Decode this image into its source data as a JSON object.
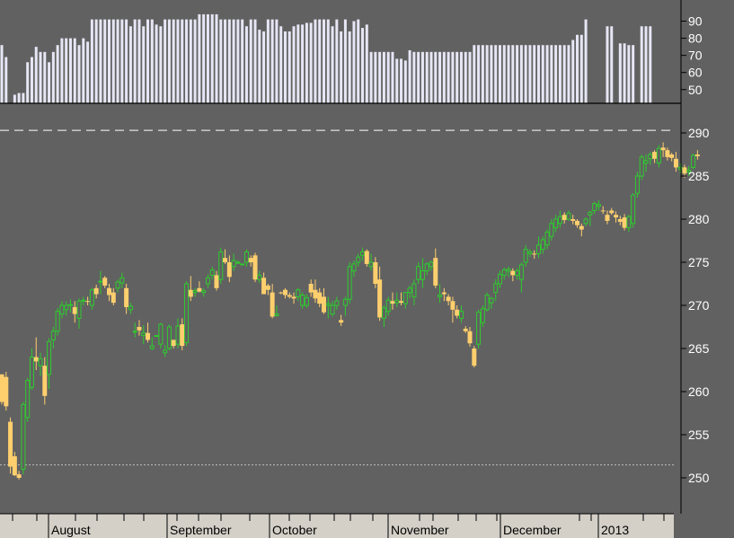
{
  "chart_data": [
    {
      "type": "bar",
      "panel": "indicator",
      "ylim": [
        42,
        95
      ],
      "y_ticks": [
        "50",
        "60",
        "70",
        "80",
        "90"
      ],
      "bar_color": "#e6e6f5",
      "values": [
        76,
        69,
        null,
        47,
        48,
        48,
        66,
        69,
        75,
        72,
        72,
        66,
        72,
        76,
        80,
        80,
        80,
        80,
        76,
        80,
        78,
        91,
        91,
        91,
        91,
        91,
        91,
        91,
        91,
        91,
        87,
        91,
        91,
        87,
        91,
        91,
        88,
        87,
        91,
        91,
        91,
        91,
        91,
        91,
        91,
        91,
        94,
        94,
        94,
        94,
        94,
        91,
        91,
        91,
        91,
        91,
        91,
        87,
        91,
        91,
        85,
        84,
        91,
        91,
        91,
        87,
        84,
        84,
        87,
        88,
        88,
        89,
        89,
        91,
        91,
        91,
        91,
        87,
        91,
        84,
        91,
        84,
        90,
        91,
        86,
        88,
        72,
        72,
        72,
        72,
        72,
        72,
        68,
        68,
        67,
        73,
        72,
        72,
        72,
        72,
        72,
        72,
        72,
        72,
        72,
        72,
        72,
        72,
        72,
        72,
        76,
        76,
        76,
        76,
        76,
        76,
        76,
        76,
        76,
        76,
        76,
        76,
        76,
        76,
        76,
        76,
        76,
        76,
        76,
        76,
        76,
        76,
        76,
        79,
        82,
        82,
        91,
        null,
        null,
        null,
        null,
        87,
        87,
        null,
        77,
        77,
        76,
        76,
        null,
        87,
        87,
        87
      ]
    },
    {
      "type": "candlestick",
      "panel": "price",
      "ylim": [
        246,
        292
      ],
      "y_ticks": [
        "250",
        "255",
        "260",
        "265",
        "270",
        "275",
        "280",
        "285",
        "290"
      ],
      "up_color": "#2ecc2e",
      "down_color": "#ffcf6e",
      "reference_lines": [
        290.3,
        251.5
      ],
      "months": [
        "August",
        "September",
        "October",
        "November",
        "December",
        "2013"
      ],
      "candles": [
        [
          262.0,
          262.0,
          258.5,
          258.8
        ],
        [
          261.7,
          262.3,
          257.8,
          258.3
        ],
        [
          256.5,
          257.0,
          250.5,
          251.3
        ],
        [
          252.5,
          253.0,
          250.2,
          250.3
        ],
        [
          250.4,
          250.8,
          249.8,
          250.0
        ],
        [
          251.0,
          258.8,
          250.4,
          258.5
        ],
        [
          257.0,
          261.6,
          256.5,
          261.3
        ],
        [
          260.5,
          265.0,
          260.2,
          264.0
        ],
        [
          264.0,
          266.3,
          262.5,
          263.5
        ],
        [
          263.0,
          264.5,
          261.8,
          263.8
        ],
        [
          263.0,
          264.0,
          258.5,
          259.5
        ],
        [
          262.0,
          266.2,
          260.3,
          265.8
        ],
        [
          266.0,
          267.5,
          265.0,
          267.0
        ],
        [
          267.0,
          269.7,
          266.5,
          269.3
        ],
        [
          269.0,
          270.5,
          268.5,
          270.0
        ],
        [
          269.5,
          270.5,
          268.8,
          270.0
        ],
        [
          270.0,
          270.7,
          269.2,
          270.1
        ],
        [
          269.8,
          270.5,
          268.0,
          269.0
        ],
        [
          268.5,
          270.8,
          267.3,
          270.5
        ],
        [
          270.5,
          271.0,
          270.0,
          270.6
        ],
        [
          270.5,
          271.0,
          270.0,
          270.4
        ],
        [
          270.0,
          272.0,
          269.5,
          271.8
        ],
        [
          272.0,
          272.4,
          270.8,
          271.3
        ],
        [
          272.8,
          274.0,
          271.3,
          272.8
        ],
        [
          273.2,
          273.4,
          272.0,
          272.3
        ],
        [
          272.0,
          272.5,
          270.5,
          271.2
        ],
        [
          271.5,
          272.0,
          270.0,
          270.3
        ],
        [
          272.0,
          273.0,
          271.5,
          272.7
        ],
        [
          272.6,
          273.8,
          272.0,
          273.2
        ],
        [
          272.0,
          272.5,
          269.0,
          269.8
        ],
        [
          269.5,
          270.3,
          269.0,
          269.9
        ],
        [
          267.0,
          268.0,
          266.3,
          267.0
        ],
        [
          267.5,
          268.3,
          266.5,
          267.1
        ],
        [
          266.5,
          267.7,
          265.5,
          266.8
        ],
        [
          266.8,
          268.0,
          265.7,
          266.0
        ],
        [
          265.0,
          266.3,
          264.8,
          265.3
        ],
        [
          266.5,
          266.5,
          266.5,
          266.5
        ],
        [
          265.5,
          268.0,
          265.0,
          267.8
        ],
        [
          264.5,
          265.4,
          264.0,
          264.8
        ],
        [
          265.0,
          267.8,
          264.8,
          267.5
        ],
        [
          266.0,
          266.0,
          265.0,
          265.3
        ],
        [
          265.5,
          268.5,
          265.0,
          267.6
        ],
        [
          267.8,
          268.5,
          264.8,
          265.3
        ],
        [
          265.7,
          272.8,
          265.3,
          272.5
        ],
        [
          271.8,
          273.4,
          270.5,
          271.0
        ],
        [
          271.5,
          272.0,
          271.0,
          271.7
        ],
        [
          272.0,
          272.8,
          271.5,
          271.6
        ],
        [
          271.5,
          272.0,
          271.0,
          271.7
        ],
        [
          272.5,
          273.6,
          272.0,
          273.2
        ],
        [
          273.5,
          274.5,
          273.0,
          274.1
        ],
        [
          273.5,
          274.0,
          271.7,
          272.0
        ],
        [
          273.0,
          276.7,
          272.5,
          276.2
        ],
        [
          275.5,
          276.5,
          274.8,
          275.0
        ],
        [
          275.0,
          275.8,
          272.7,
          273.3
        ],
        [
          274.5,
          276.0,
          274.0,
          275.2
        ],
        [
          274.9,
          275.2,
          274.8,
          275.0
        ],
        [
          274.8,
          274.8,
          274.8,
          274.8
        ],
        [
          275.0,
          276.5,
          274.5,
          276.2
        ],
        [
          275.5,
          275.8,
          274.5,
          275.0
        ],
        [
          275.8,
          276.1,
          272.7,
          273.0
        ],
        [
          273.0,
          274.0,
          272.6,
          273.5
        ],
        [
          273.2,
          273.8,
          271.3,
          271.3
        ],
        [
          272.3,
          272.5,
          271.2,
          271.8
        ],
        [
          271.5,
          272.5,
          268.5,
          268.7
        ],
        [
          268.8,
          270.0,
          268.7,
          269.0
        ],
        [
          271.5,
          271.6,
          271.3,
          271.4
        ],
        [
          271.8,
          272.0,
          270.8,
          271.2
        ],
        [
          271.2,
          271.5,
          270.8,
          271.0
        ],
        [
          271.0,
          271.5,
          270.2,
          270.8
        ],
        [
          271.0,
          272.0,
          270.5,
          271.8
        ],
        [
          270.0,
          271.5,
          269.6,
          271.2
        ],
        [
          270.0,
          271.3,
          269.7,
          270.9
        ],
        [
          272.5,
          273.0,
          271.0,
          271.5
        ],
        [
          271.8,
          273.0,
          270.3,
          270.8
        ],
        [
          271.5,
          272.0,
          269.8,
          270.2
        ],
        [
          271.0,
          272.0,
          269.0,
          269.2
        ],
        [
          270.0,
          271.0,
          268.5,
          270.2
        ],
        [
          269.0,
          270.5,
          268.7,
          270.0
        ],
        [
          270.0,
          271.0,
          269.5,
          270.5
        ],
        [
          268.3,
          268.9,
          267.6,
          268.0
        ],
        [
          270.0,
          271.0,
          268.8,
          270.7
        ],
        [
          270.7,
          275.0,
          270.2,
          274.5
        ],
        [
          274.0,
          275.2,
          273.3,
          274.8
        ],
        [
          275.0,
          276.0,
          274.5,
          275.6
        ],
        [
          275.8,
          276.7,
          275.2,
          276.2
        ],
        [
          276.3,
          276.5,
          274.5,
          274.8
        ],
        [
          274.5,
          276.0,
          274.0,
          275.0
        ],
        [
          275.0,
          275.6,
          272.0,
          272.5
        ],
        [
          273.0,
          274.5,
          268.2,
          268.6
        ],
        [
          268.5,
          270.0,
          267.5,
          269.7
        ],
        [
          269.3,
          271.0,
          268.8,
          270.6
        ],
        [
          270.5,
          271.5,
          269.5,
          270.2
        ],
        [
          270.3,
          271.5,
          269.8,
          270.6
        ],
        [
          270.5,
          271.5,
          270.0,
          270.3
        ],
        [
          270.2,
          271.5,
          269.6,
          271.5
        ],
        [
          271.5,
          272.3,
          270.8,
          272.0
        ],
        [
          271.0,
          273.0,
          270.0,
          272.5
        ],
        [
          273.0,
          275.0,
          272.5,
          274.5
        ],
        [
          273.0,
          275.5,
          272.0,
          274.0
        ],
        [
          274.0,
          275.0,
          273.5,
          274.8
        ],
        [
          274.5,
          275.2,
          274.0,
          275.0
        ],
        [
          275.5,
          276.6,
          272.0,
          272.3
        ],
        [
          271.0,
          272.5,
          270.3,
          271.2
        ],
        [
          271.5,
          272.0,
          270.5,
          271.3
        ],
        [
          271.0,
          271.3,
          270.0,
          270.5
        ],
        [
          270.5,
          271.0,
          268.0,
          269.5
        ],
        [
          269.5,
          270.0,
          268.5,
          268.8
        ],
        [
          268.5,
          270.0,
          268.0,
          269.3
        ],
        [
          267.3,
          267.6,
          266.8,
          267.0
        ],
        [
          267.0,
          267.5,
          265.2,
          265.6
        ],
        [
          265.0,
          265.3,
          262.8,
          263.0
        ],
        [
          265.5,
          269.5,
          265.0,
          269.2
        ],
        [
          268.0,
          270.0,
          267.5,
          269.6
        ],
        [
          269.5,
          271.5,
          269.3,
          271.2
        ],
        [
          270.3,
          271.0,
          269.6,
          270.8
        ],
        [
          271.5,
          273.0,
          270.5,
          272.5
        ],
        [
          272.5,
          274.0,
          272.0,
          273.6
        ],
        [
          273.5,
          274.4,
          273.0,
          274.1
        ],
        [
          274.0,
          274.5,
          273.3,
          274.2
        ],
        [
          274.0,
          274.3,
          272.8,
          273.5
        ],
        [
          273.5,
          274.3,
          273.0,
          274.0
        ],
        [
          273.0,
          275.0,
          271.5,
          274.7
        ],
        [
          275.0,
          277.0,
          274.5,
          276.5
        ],
        [
          276.0,
          276.5,
          275.6,
          276.2
        ],
        [
          276.0,
          276.4,
          275.4,
          275.9
        ],
        [
          276.0,
          278.0,
          275.5,
          277.0
        ],
        [
          276.5,
          278.0,
          276.0,
          277.6
        ],
        [
          277.0,
          278.8,
          276.5,
          278.5
        ],
        [
          278.0,
          280.0,
          277.5,
          279.5
        ],
        [
          279.0,
          280.5,
          278.5,
          280.0
        ],
        [
          279.5,
          281.0,
          279.0,
          280.3
        ],
        [
          280.5,
          280.8,
          279.5,
          279.9
        ],
        [
          280.0,
          281.0,
          279.8,
          280.7
        ],
        [
          280.0,
          280.5,
          279.4,
          279.8
        ],
        [
          279.8,
          280.0,
          279.0,
          279.3
        ],
        [
          279.2,
          279.5,
          278.0,
          278.8
        ],
        [
          279.5,
          280.2,
          279.2,
          280.0
        ],
        [
          280.5,
          281.0,
          279.2,
          280.8
        ],
        [
          281.0,
          282.0,
          280.6,
          281.8
        ],
        [
          281.5,
          282.2,
          281.0,
          281.7
        ],
        [
          281.0,
          281.5,
          280.6,
          280.9
        ],
        [
          280.5,
          281.0,
          279.4,
          279.8
        ],
        [
          281.0,
          281.3,
          280.5,
          280.7
        ],
        [
          280.5,
          280.9,
          279.6,
          280.2
        ],
        [
          280.0,
          280.4,
          279.3,
          279.7
        ],
        [
          280.2,
          280.6,
          278.7,
          279.0
        ],
        [
          279.0,
          280.5,
          278.5,
          280.3
        ],
        [
          279.5,
          283.0,
          279.0,
          282.8
        ],
        [
          283.0,
          285.5,
          282.5,
          285.0
        ],
        [
          285.0,
          287.5,
          284.5,
          287.2
        ],
        [
          286.5,
          287.5,
          285.5,
          286.8
        ],
        [
          287.0,
          287.8,
          286.3,
          287.5
        ],
        [
          287.8,
          288.0,
          286.5,
          287.0
        ],
        [
          286.5,
          288.6,
          286.0,
          288.2
        ],
        [
          288.3,
          288.9,
          287.2,
          288.0
        ],
        [
          288.0,
          288.3,
          286.8,
          287.2
        ],
        [
          287.5,
          287.7,
          286.7,
          287.1
        ],
        [
          287.0,
          287.8,
          285.5,
          286.0
        ],
        [
          285.8,
          286.5,
          285.3,
          286.0
        ],
        [
          286.0,
          286.3,
          284.8,
          285.3
        ],
        [
          285.5,
          286.2,
          285.0,
          285.7
        ],
        [
          286.0,
          287.6,
          285.8,
          287.4
        ],
        [
          287.5,
          288.0,
          286.9,
          287.3
        ]
      ]
    }
  ]
}
